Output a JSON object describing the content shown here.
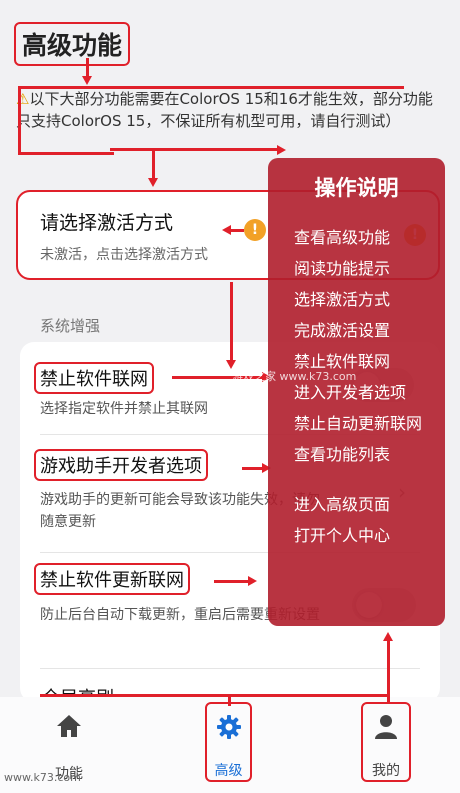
{
  "header": {
    "title": "高级功能"
  },
  "notice": {
    "icon": "warning-icon",
    "text": "以下大部分功能需要在ColorOS 15和16才能生效，部分功能只支持ColorOS 15，不保证所有机型可用，请自行测试）"
  },
  "activation": {
    "title": "请选择激活方式",
    "subtitle": "未激活，点击选择激活方式",
    "badge": "!"
  },
  "section": {
    "label": "系统增强"
  },
  "items": [
    {
      "title": "禁止软件联网",
      "desc": "选择指定软件并禁止其联网"
    },
    {
      "title": "游戏助手开发者选项",
      "desc": "游戏助手的更新可能会导致该功能失效，请勿随意更新"
    },
    {
      "title": "禁止软件更新联网",
      "desc": "防止后台自动下载更新，重启后需要重新设置"
    },
    {
      "title": "全局高刷"
    }
  ],
  "overlay": {
    "title": "操作说明",
    "steps": [
      "查看高级功能",
      "阅读功能提示",
      "选择激活方式",
      "完成激活设置",
      "禁止软件联网",
      "进入开发者选项",
      "禁止自动更新联网",
      "查看功能列表",
      "进入高级页面",
      "打开个人中心"
    ]
  },
  "tabs": [
    {
      "label": "功能",
      "icon": "home-icon"
    },
    {
      "label": "高级",
      "icon": "gear-icon",
      "active": true
    },
    {
      "label": "我的",
      "icon": "person-icon"
    }
  ],
  "watermark": {
    "center": "k73",
    "center_sub": "游戏之家 www.k73.com",
    "corner": "www.k73.com"
  },
  "colors": {
    "accent": "#1a6fd6",
    "annotation": "#e0202a",
    "overlay": "#b01e2c"
  }
}
